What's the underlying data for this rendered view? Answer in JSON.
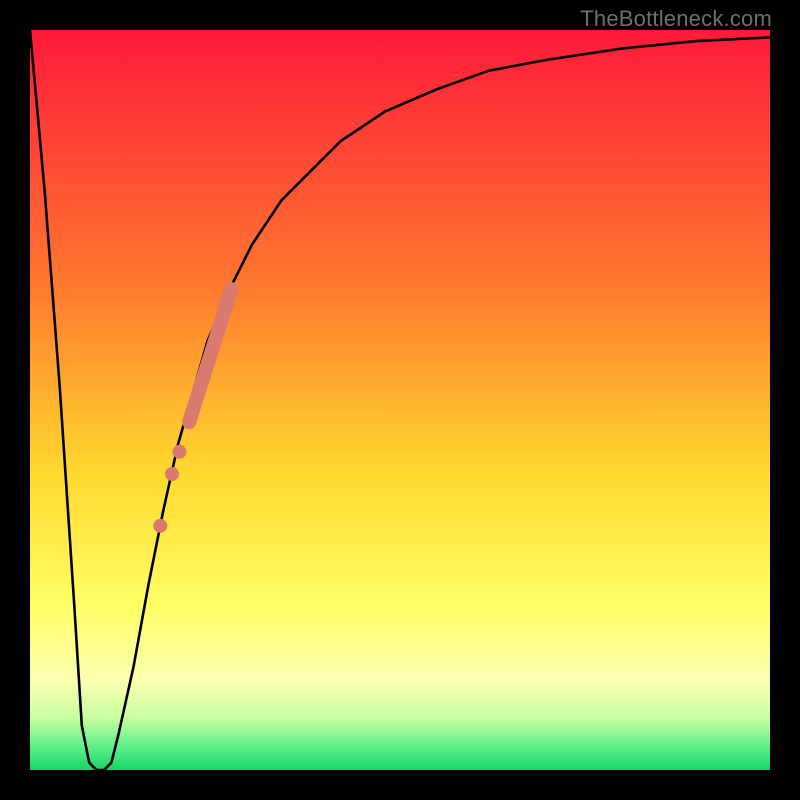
{
  "watermark": "TheBottleneck.com",
  "colors": {
    "frame": "#000000",
    "curve": "#000000",
    "dot_fill": "#d97a6f",
    "gradient_stops": [
      {
        "pct": 0,
        "color": "#ff1a3a"
      },
      {
        "pct": 35,
        "color": "#ff7a2e"
      },
      {
        "pct": 60,
        "color": "#ffd92e"
      },
      {
        "pct": 78,
        "color": "#ffff66"
      },
      {
        "pct": 88,
        "color": "#fbffb0"
      },
      {
        "pct": 93,
        "color": "#c7ff9e"
      },
      {
        "pct": 97,
        "color": "#5aee8a"
      },
      {
        "pct": 100,
        "color": "#18d468"
      }
    ]
  },
  "chart_data": {
    "type": "line",
    "title": "",
    "xlabel": "",
    "ylabel": "",
    "xlim": [
      0,
      100
    ],
    "ylim": [
      0,
      100
    ],
    "series": [
      {
        "name": "bottleneck-curve",
        "x": [
          0,
          2,
          4,
          6,
          7,
          8,
          9,
          10,
          11,
          12,
          14,
          16,
          18,
          20,
          22,
          24,
          27,
          30,
          34,
          38,
          42,
          48,
          55,
          62,
          70,
          80,
          90,
          100
        ],
        "y": [
          100,
          78,
          52,
          22,
          6,
          1,
          0,
          0,
          1,
          5,
          14,
          25,
          35,
          44,
          51,
          58,
          65,
          71,
          77,
          81,
          85,
          89,
          92,
          94.5,
          96,
          97.5,
          98.5,
          99
        ]
      }
    ],
    "points": [
      {
        "name": "band-start",
        "x": 21.5,
        "y": 47
      },
      {
        "name": "band-end",
        "x": 27.2,
        "y": 65
      },
      {
        "name": "dot-a",
        "x": 20.2,
        "y": 43
      },
      {
        "name": "dot-b",
        "x": 19.2,
        "y": 40
      },
      {
        "name": "dot-c",
        "x": 17.6,
        "y": 33
      }
    ]
  }
}
